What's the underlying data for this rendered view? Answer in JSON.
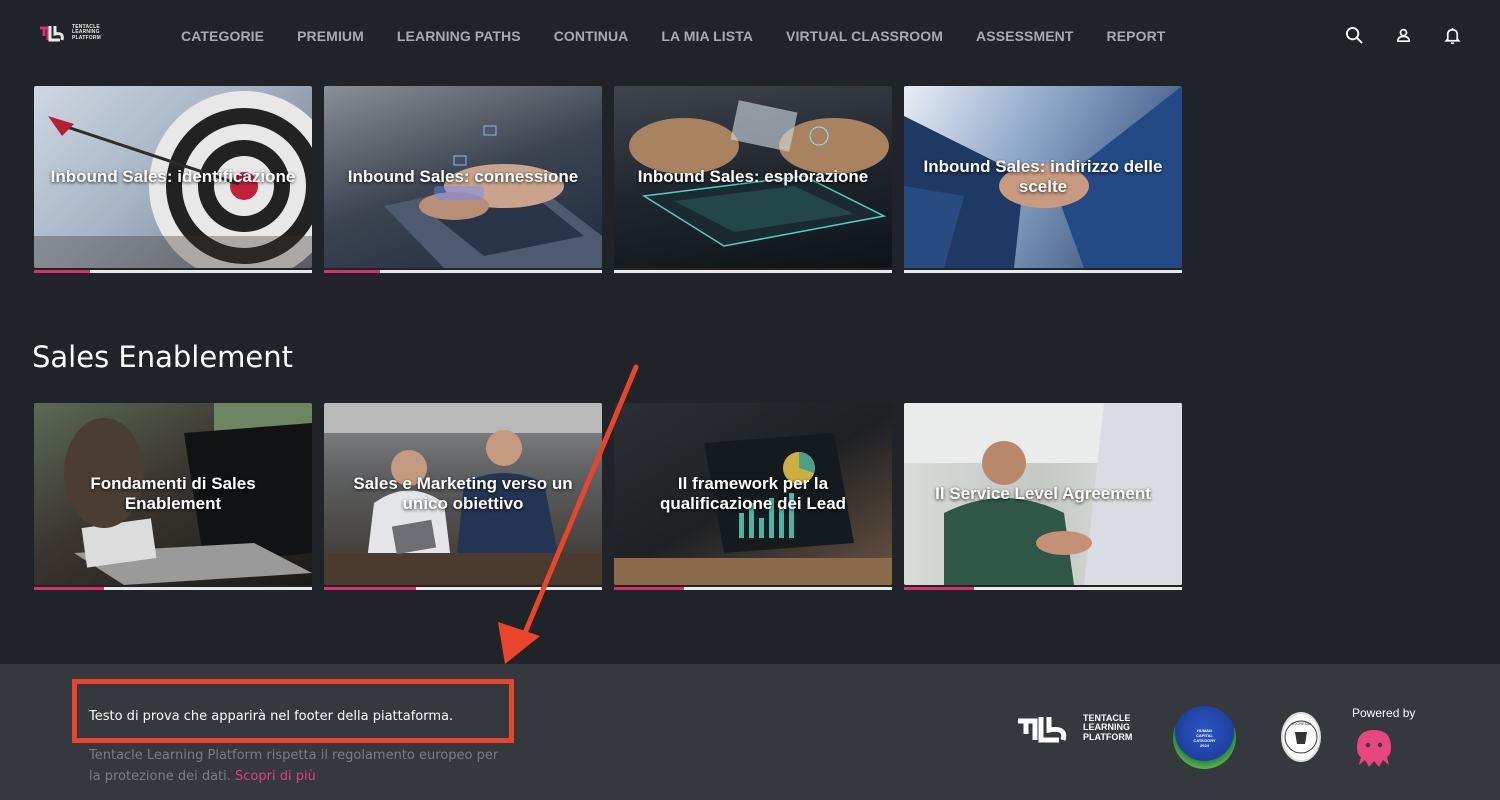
{
  "header": {
    "logo_text": [
      "TENTACLE",
      "LEARNING",
      "PLATFORM"
    ],
    "nav": [
      {
        "label": "CATEGORIE"
      },
      {
        "label": "PREMIUM"
      },
      {
        "label": "LEARNING PATHS"
      },
      {
        "label": "CONTINUA"
      },
      {
        "label": "LA MIA LISTA"
      },
      {
        "label": "VIRTUAL CLASSROOM"
      },
      {
        "label": "ASSESSMENT"
      },
      {
        "label": "REPORT"
      }
    ],
    "icons": [
      "search-icon",
      "user-icon",
      "bell-icon"
    ]
  },
  "row1": {
    "cards": [
      {
        "title": "Inbound Sales: identificazione",
        "progress": 0.2
      },
      {
        "title": "Inbound Sales: connessione",
        "progress": 0.2
      },
      {
        "title": "Inbound Sales: esplorazione",
        "progress": 0.0
      },
      {
        "title": "Inbound Sales: indirizzo delle scelte",
        "progress": 0.0
      }
    ]
  },
  "section": {
    "title": "Sales Enablement"
  },
  "row2": {
    "cards": [
      {
        "title": "Fondamenti di Sales Enablement",
        "progress": 0.25
      },
      {
        "title": "Sales e Marketing verso un unico obiettivo",
        "progress": 0.33
      },
      {
        "title": "Il framework per la qualificazione dei Lead",
        "progress": 0.25
      },
      {
        "title": "Il Service Level Agreement",
        "progress": 0.25
      }
    ]
  },
  "footer": {
    "custom_text": "Testo di prova che apparirà nel footer della piattaforma.",
    "privacy_text": "Tentacle Learning Platform rispetta il regolamento europeo per la protezione dei dati.",
    "privacy_link": "Scopri di più",
    "logo_text": [
      "TENTACLE",
      "LEARNING",
      "PLATFORM"
    ],
    "badge_text": [
      "HUMAN",
      "CAPITAL",
      "CATEGORY",
      "2024"
    ],
    "seal_text": "ACCREDIA",
    "powered_by": "Powered by"
  },
  "colors": {
    "background": "#202327",
    "footer": "#35383d",
    "accent": "#d7316c",
    "annotation": "#e9452d"
  }
}
